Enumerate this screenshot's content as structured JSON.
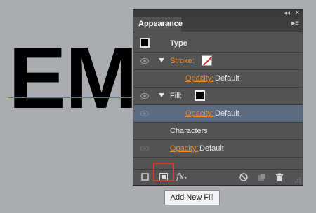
{
  "canvas": {
    "art_text": "EME"
  },
  "panel": {
    "title": "Appearance",
    "header_icons": {
      "collapse": "double-chevron-icon",
      "close": "close-icon",
      "menu": "panel-menu-icon"
    },
    "rows": [
      {
        "label": "Type"
      },
      {
        "label": "Stroke:"
      },
      {
        "opacity_label": "Opacity:",
        "opacity_value": "Default"
      },
      {
        "label": "Fill:"
      },
      {
        "opacity_label": "Opacity:",
        "opacity_value": "Default"
      },
      {
        "label": "Characters"
      },
      {
        "opacity_label": "Opacity:",
        "opacity_value": "Default"
      }
    ],
    "bottom_tools": {
      "fx_label": "fx"
    }
  },
  "tooltip": {
    "text": "Add New Fill"
  },
  "colors": {
    "accent_orange": "#f08a24",
    "selected_row": "#5b6b82",
    "highlight_red": "#d83b2e"
  }
}
